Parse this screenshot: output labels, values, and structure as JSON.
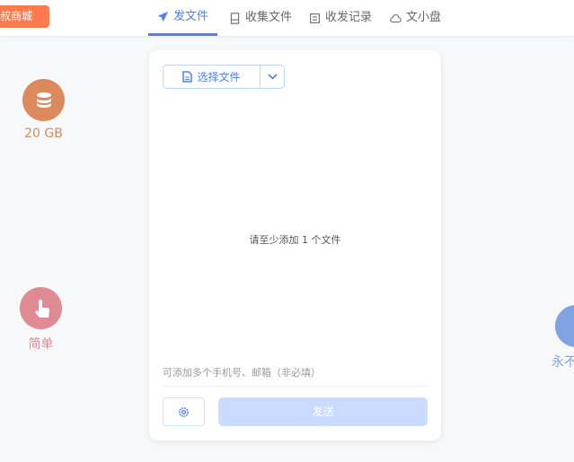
{
  "header": {
    "shop_label": "叔商城",
    "tabs": [
      {
        "label": "发文件",
        "icon": "paper-plane-icon",
        "active": true
      },
      {
        "label": "收集文件",
        "icon": "inbox-icon"
      },
      {
        "label": "收发记录",
        "icon": "record-icon"
      },
      {
        "label": "文小盘",
        "icon": "cloud-icon"
      }
    ]
  },
  "card": {
    "select_label": "选择文件",
    "empty_text": "请至少添加 1 个文件",
    "recipient_placeholder": "可添加多个手机号、邮箱（非必填）",
    "send_label": "发送"
  },
  "features": [
    {
      "label": "20 GB",
      "icon": "database-icon",
      "color": "#dc8a5c"
    },
    {
      "label": "简单",
      "icon": "hand-pointer-icon",
      "color": "#e08a93"
    },
    {
      "label": "永不",
      "icon": "up-arrow-icon",
      "color": "#7fa3e0"
    }
  ],
  "colors": {
    "accent": "#4f7ef8",
    "shop": "#ff7a4c"
  }
}
